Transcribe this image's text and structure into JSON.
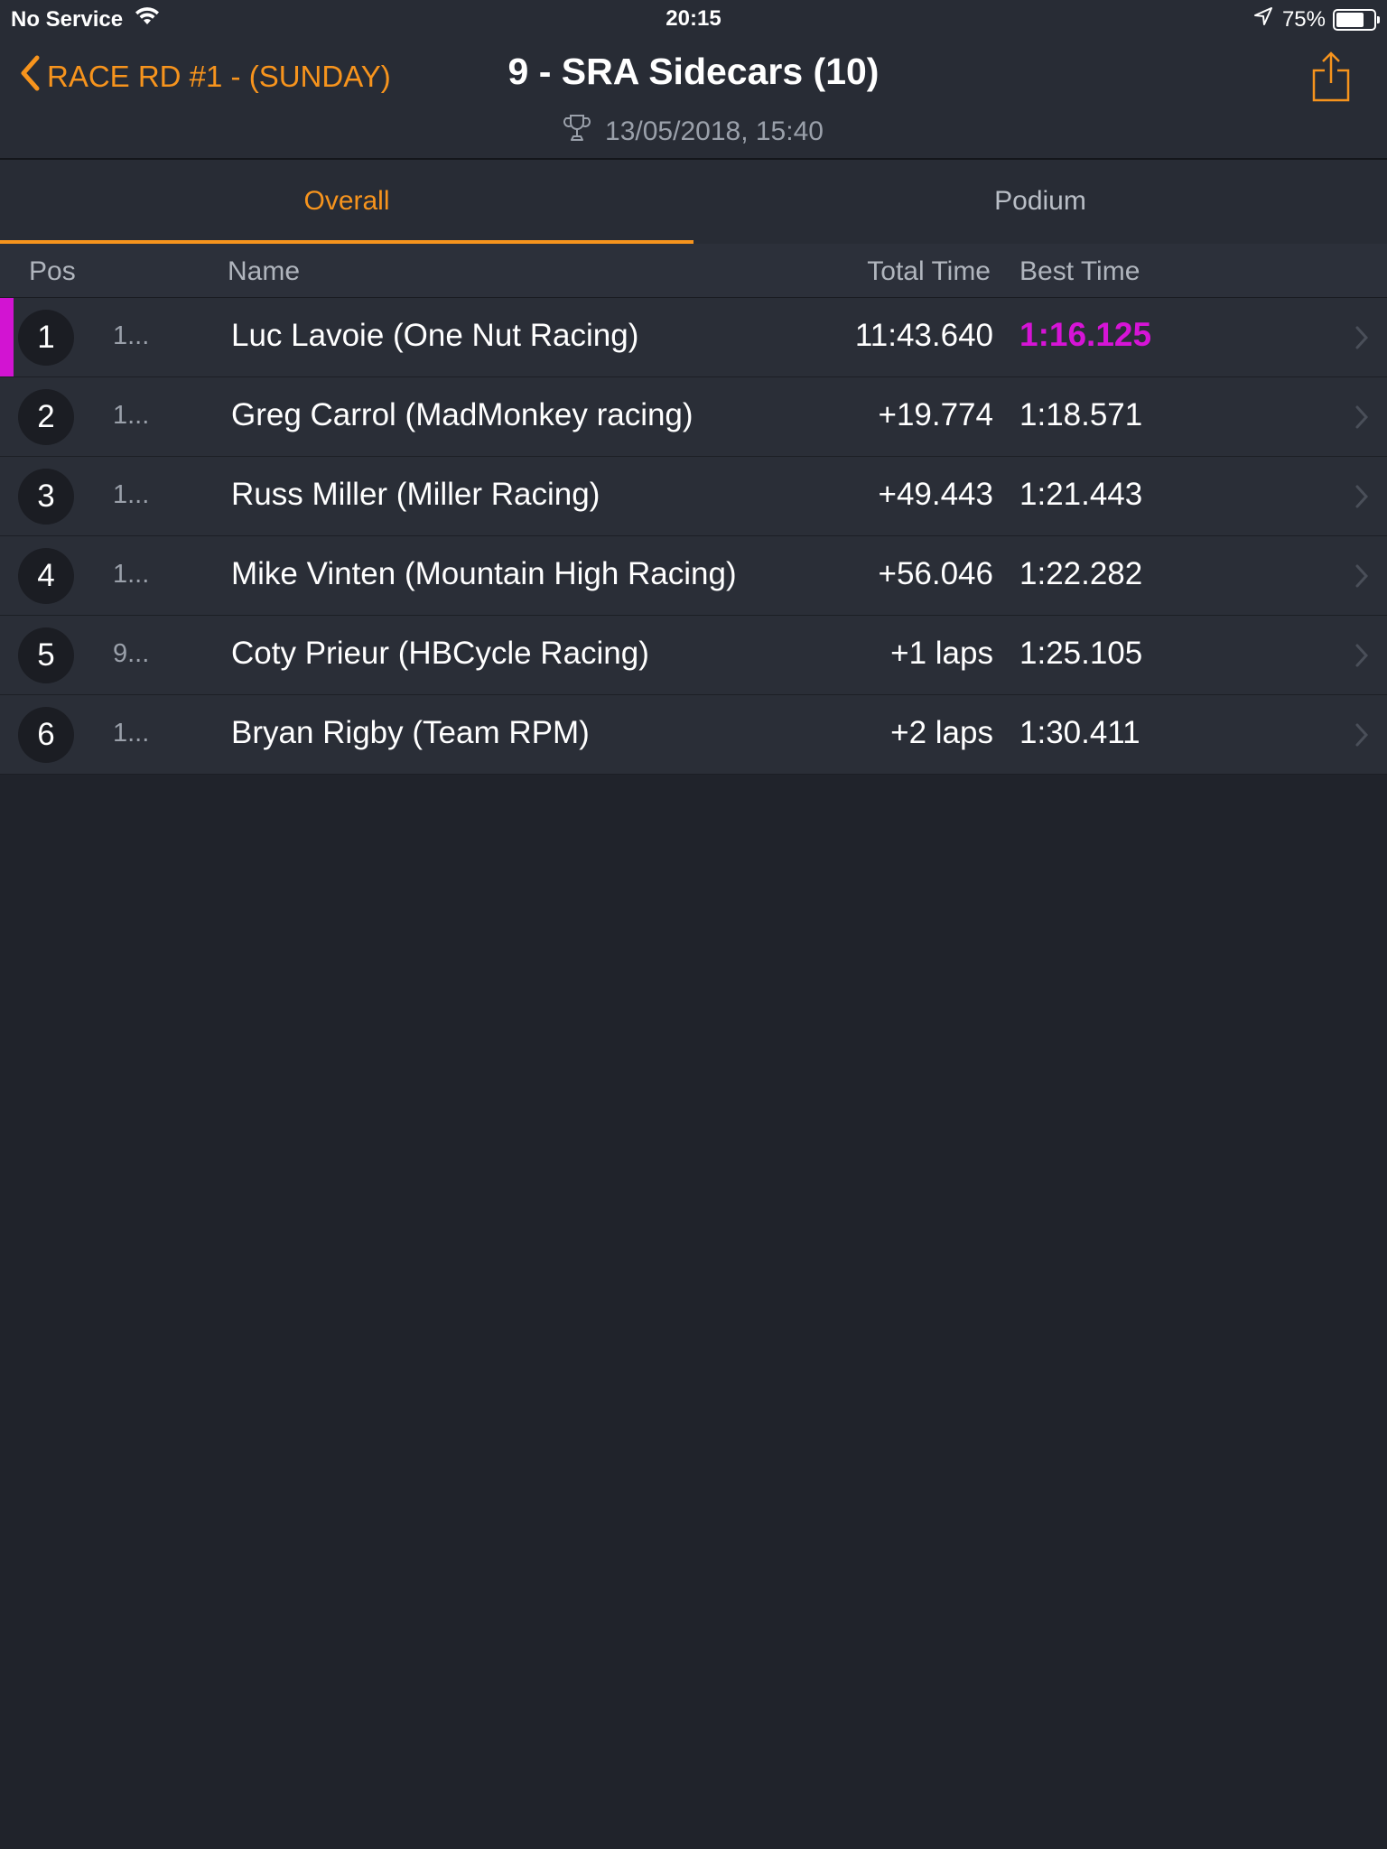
{
  "status_bar": {
    "carrier": "No Service",
    "time": "20:15",
    "battery_percent": "75%",
    "battery_level": 0.75,
    "icons": [
      "wifi-icon",
      "location-arrow-icon",
      "battery-icon"
    ]
  },
  "nav": {
    "back_label": "RACE RD #1 - (SUNDAY)",
    "title": "9 - SRA Sidecars (10)",
    "subtitle": "13/05/2018, 15:40",
    "icons": [
      "chevron-left-icon",
      "trophy-icon",
      "share-icon"
    ]
  },
  "tabs": [
    {
      "label": "Overall",
      "active": true
    },
    {
      "label": "Podium",
      "active": false
    }
  ],
  "table": {
    "headers": {
      "pos": "Pos",
      "name": "Name",
      "total_time": "Total Time",
      "best_time": "Best Time"
    },
    "rows": [
      {
        "pos": "1",
        "num": "1...",
        "name": "Luc Lavoie (One Nut Racing)",
        "total": "11:43.640",
        "best": "1:16.125",
        "fastest": true
      },
      {
        "pos": "2",
        "num": "1...",
        "name": "Greg Carrol (MadMonkey racing)",
        "total": "+19.774",
        "best": "1:18.571",
        "fastest": false
      },
      {
        "pos": "3",
        "num": "1...",
        "name": "Russ Miller (Miller Racing)",
        "total": "+49.443",
        "best": "1:21.443",
        "fastest": false
      },
      {
        "pos": "4",
        "num": "1...",
        "name": "Mike Vinten (Mountain High Racing)",
        "total": "+56.046",
        "best": "1:22.282",
        "fastest": false
      },
      {
        "pos": "5",
        "num": "9...",
        "name": "Coty Prieur (HBCycle Racing)",
        "total": "+1 laps",
        "best": "1:25.105",
        "fastest": false
      },
      {
        "pos": "6",
        "num": "1...",
        "name": "Bryan Rigby (Team RPM)",
        "total": "+2 laps",
        "best": "1:30.411",
        "fastest": false
      }
    ]
  },
  "colors": {
    "accent": "#f7941d",
    "fastest": "#d614d6",
    "background": "#20232b",
    "row_background": "#2a2e37"
  }
}
